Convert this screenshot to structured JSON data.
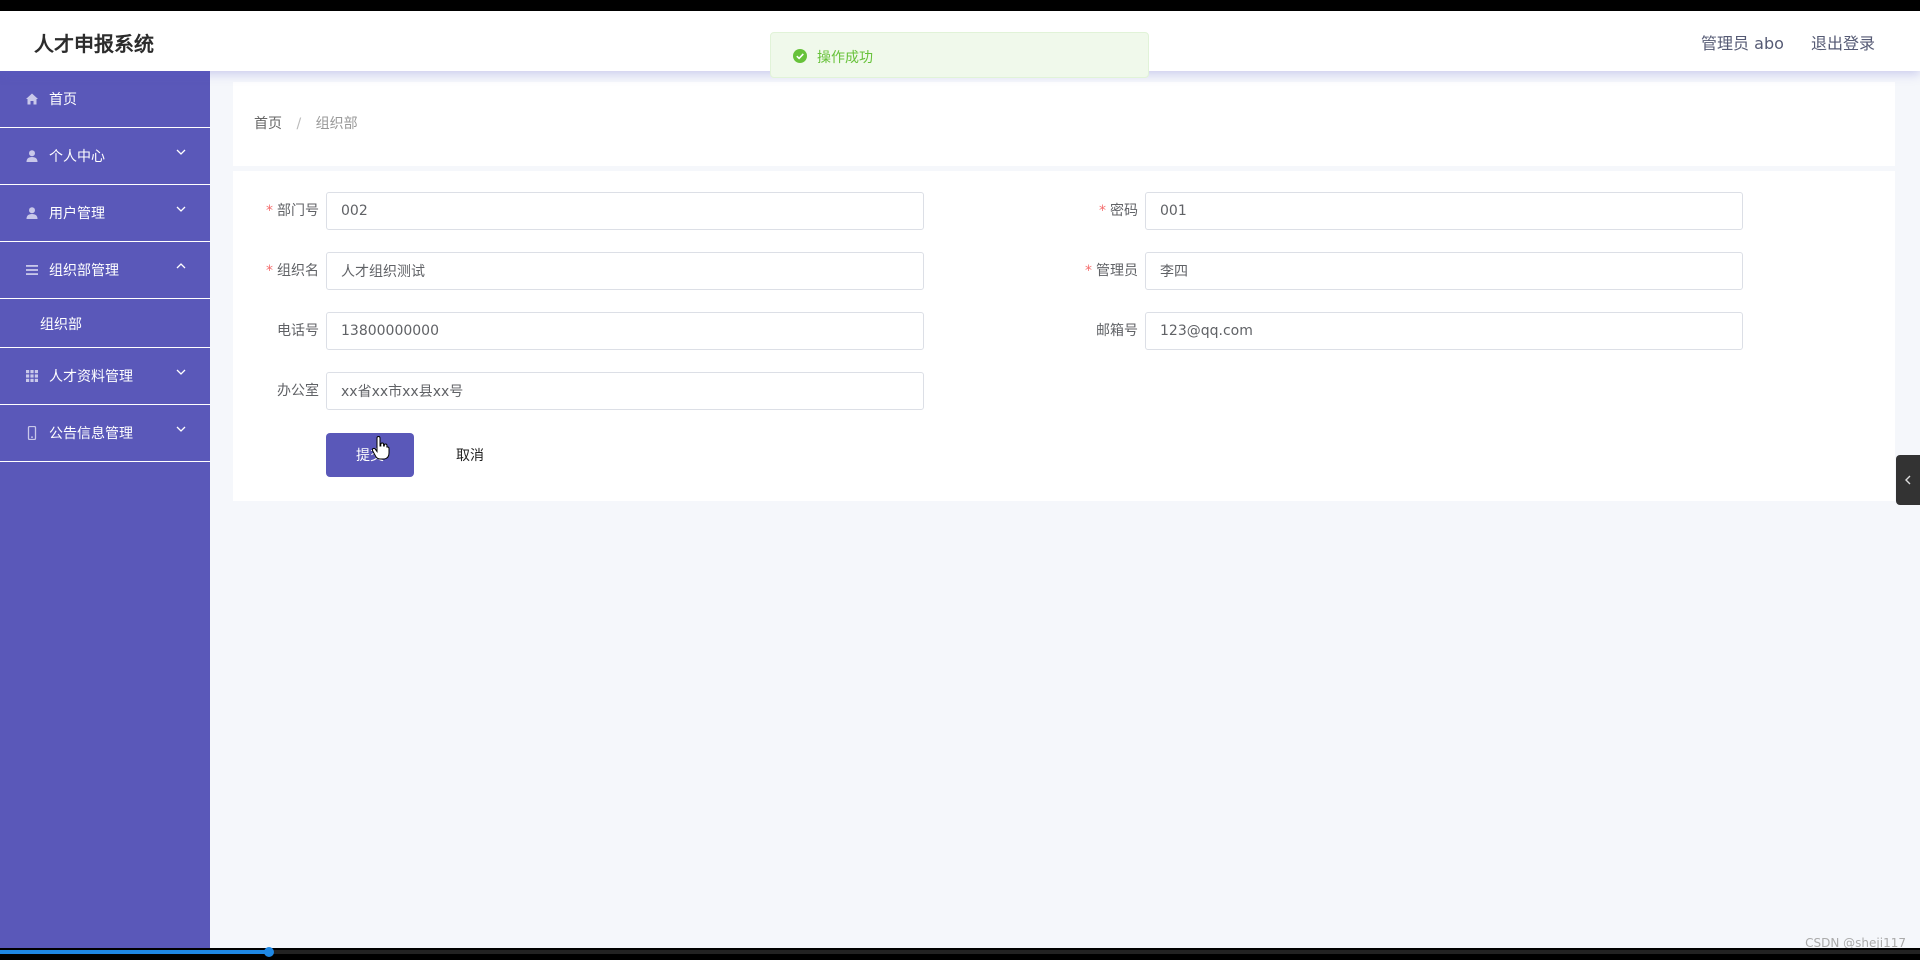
{
  "header": {
    "title": "人才申报系统",
    "user_label": "管理员 abo",
    "logout_label": "退出登录"
  },
  "toast": {
    "message": "操作成功",
    "color": "#67c23a"
  },
  "sidebar": {
    "bg_color": "#5a58b9",
    "items": [
      {
        "label": "首页",
        "icon": "home-icon"
      },
      {
        "label": "个人中心",
        "icon": "user-icon",
        "chevron": "down"
      },
      {
        "label": "用户管理",
        "icon": "user-icon",
        "chevron": "down"
      },
      {
        "label": "组织部管理",
        "icon": "menu-icon",
        "chevron": "up"
      },
      {
        "label": "人才资料管理",
        "icon": "grid-icon",
        "chevron": "down"
      },
      {
        "label": "公告信息管理",
        "icon": "phone-icon",
        "chevron": "down"
      }
    ],
    "submenu": [
      {
        "label": "组织部"
      }
    ]
  },
  "breadcrumb": {
    "home": "首页",
    "separator": "/",
    "current": "组织部"
  },
  "form": {
    "fields": {
      "dept_no": {
        "label": "部门号",
        "value": "002",
        "required": true
      },
      "password": {
        "label": "密码",
        "value": "001",
        "required": true
      },
      "org_name": {
        "label": "组织名",
        "value": "人才组织测试",
        "required": true
      },
      "admin": {
        "label": "管理员",
        "value": "李四",
        "required": true
      },
      "phone": {
        "label": "电话号",
        "value": "13800000000",
        "required": false
      },
      "email": {
        "label": "邮箱号",
        "value": "123@qq.com",
        "required": false
      },
      "office": {
        "label": "办公室",
        "value": "xx省xx市xx县xx号",
        "required": false
      }
    },
    "submit_label": "提交",
    "cancel_label": "取消"
  },
  "watermark": "CSDN @sheji117",
  "video_progress": 0.14
}
